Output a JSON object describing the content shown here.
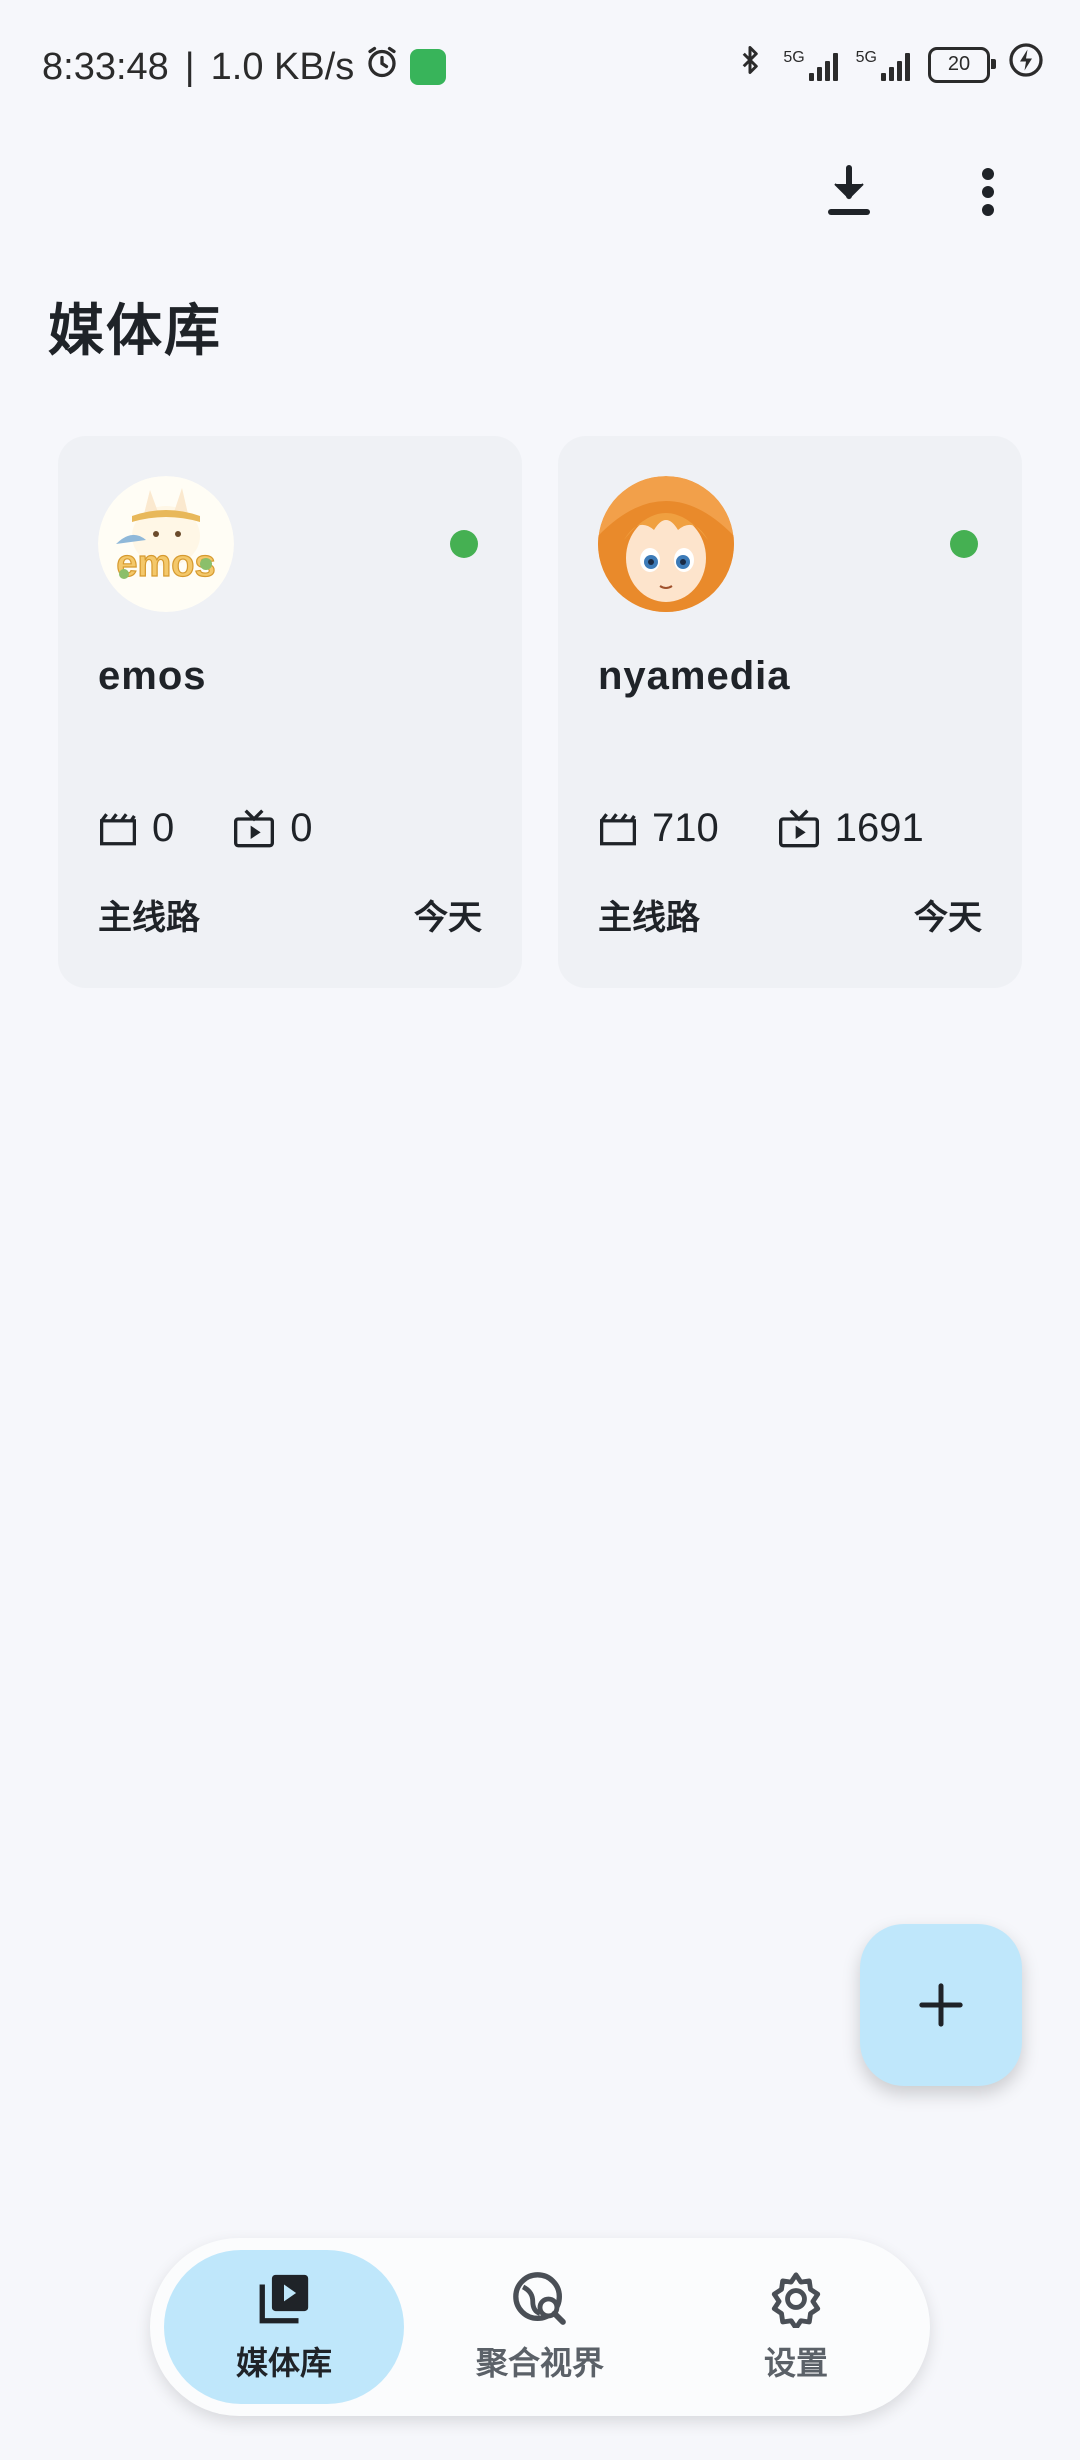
{
  "status_bar": {
    "time": "8:33:48",
    "separator": "|",
    "net_speed": "1.0 KB/s",
    "network_1": "5G",
    "network_2": "5G",
    "battery": "20"
  },
  "header": {
    "title": "媒体库",
    "download_icon": "download-icon",
    "more_icon": "more-vert-icon"
  },
  "servers": [
    {
      "name": "emos",
      "status_color": "#45b052",
      "movies_count": "0",
      "series_count": "0",
      "route": "主线路",
      "updated": "今天",
      "avatar_icon": "emos-avatar"
    },
    {
      "name": "nyamedia",
      "status_color": "#45b052",
      "movies_count": "710",
      "series_count": "1691",
      "route": "主线路",
      "updated": "今天",
      "avatar_icon": "anime-girl-avatar"
    }
  ],
  "fab": {
    "icon": "plus-icon"
  },
  "bottom_nav": {
    "items": [
      {
        "label": "媒体库",
        "icon": "library-icon",
        "active": true
      },
      {
        "label": "聚合视界",
        "icon": "globe-search-icon",
        "active": false
      },
      {
        "label": "设置",
        "icon": "gear-icon",
        "active": false
      }
    ]
  },
  "colors": {
    "background": "#f6f7fb",
    "card": "#eff1f5",
    "accent": "#bfe7fb",
    "online": "#45b052"
  }
}
